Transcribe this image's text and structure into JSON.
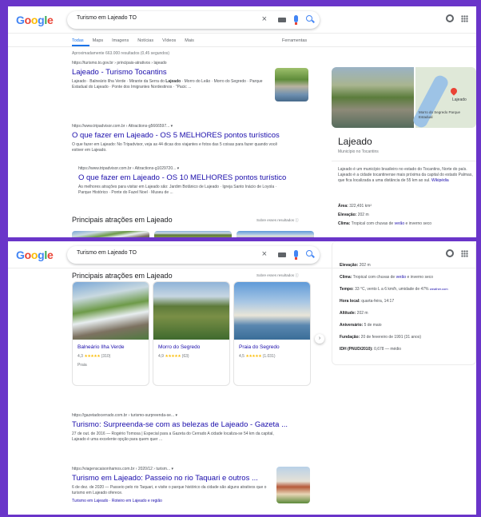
{
  "header": {
    "logo_letters": [
      "G",
      "o",
      "o",
      "g",
      "l",
      "e"
    ],
    "query": "Turismo em Lajeado TO",
    "icons": [
      "close-icon",
      "keyboard-icon",
      "mic-icon",
      "search-icon",
      "gear-icon",
      "apps-icon"
    ]
  },
  "tabs": [
    "Todas",
    "Maps",
    "Imagens",
    "Notícias",
    "Vídeos",
    "Mais"
  ],
  "tools_label": "Ferramentas",
  "stats": "Aproximadamente 663.000 resultados (0,45 segundos)",
  "results_top": [
    {
      "url": "https://turismo.to.gov.br › principais-atrativos › lajeado",
      "title": "Lajeado - Turismo Tocantins",
      "snippet_pre": "Lajeado · Balneário Ilha Verde · Mirante da Serra do ",
      "snippet_bold": "Lajeado",
      "snippet_post": " · Morro do Leão · Morro do Segredo · Parque Estadual do Lajeado · Ponte dos Imigrantes Nordestinos · \"Pacic ..."
    },
    {
      "url": "https://www.tripadvisor.com.br › Attractions-g5666597... ▾",
      "title": "O que fazer em Lajeado - OS 5 MELHORES pontos turísticos",
      "snippet": "O que fazer em Lajeado: No Tripadvisor, veja as 44 dicas dos viajantes e fotos das 5 coisas para fazer quando você estiver em Lajeado."
    },
    {
      "url": "https://www.tripadvisor.com.br › Attractions-g1029720... ▾",
      "title": "O que fazer em Lajeado - OS 10 MELHORES pontos turísticos",
      "snippet": "As melhores atrações para visitar em Lajeado são: Jardim Botânico de Lajeado · Igreja Santo Inácio de Loyola · Parque Histórico · Ponte do Fazel Noel · Museu de ..."
    }
  ],
  "attractions": {
    "title": "Principais atrações em Lajeado",
    "note": "Sobre esses resultados ⓘ",
    "cards": [
      {
        "name": "Balneário Ilha Verde",
        "rating": "4,3",
        "stars": "★★★★★",
        "reviews": "(310)",
        "type": "Praia"
      },
      {
        "name": "Morro do Segredo",
        "rating": "4,9",
        "stars": "★★★★★",
        "reviews": "(63)",
        "type": ""
      },
      {
        "name": "Praia do Segredo",
        "rating": "4,5",
        "stars": "★★★★★",
        "reviews": "(1.031)",
        "type": ""
      }
    ]
  },
  "results_bottom": [
    {
      "url": "https://gazetadocerrado.com.br › turismo-surpreenda-se... ▾",
      "title": "Turismo: Surpreenda-se com as belezas de Lajeado - Gazeta ...",
      "snippet": "27 de out. de 2016 — Rogério Tomosa | Especial para a Gazeta do Cerrado A cidade localiza-se 54 km da capital, Lajeado é uma excelente opção para quem quer ..."
    },
    {
      "url": "https://viagenscaisonhamos.com.br › 2020/12 › turism... ▾",
      "title": "Turismo em Lajeado: Passeio no rio Taquari e outros ...",
      "snippet": "6 de dez. de 2020 — Passeio pelo rio Taquari, e visite o parque histórico da cidade são alguns atrativos que o turismo em Lajeado oferece.",
      "links": "Turismo em Lajeado · Roteiro em Lajeado e região"
    }
  ],
  "knowledge_panel": {
    "map_label": "Lajeado",
    "map_poi": "Morro do Segredo Parque Estadual",
    "title": "Lajeado",
    "subtitle": "Município no Tocantins",
    "desc_pre": "Lajeado é um município brasileiro no estado do Tocantins, Norte do país. Lajeado é a cidade tocantinense mais próxima da capital do estado Palmas, que fica localizada a uma distância de 55 km ao sul. ",
    "desc_link": "Wikipédia",
    "area_label": "Área:",
    "area_value": "322,491 km²",
    "elev_label": "Elevação:",
    "elev_value": "202 m",
    "clima_label": "Clima:",
    "clima_pre": "Tropical com chuvas de ",
    "clima_link": "verão",
    "clima_post": " e inverno seco",
    "tempo_label": "Tempo:",
    "tempo_value": "33 °C, vento L a 6 km/h, umidade de 47%",
    "tempo_link": "weather.com",
    "hora_label": "Hora local:",
    "hora_value": "quarta-feira, 14:17",
    "alt_label": "Altitude:",
    "alt_value": "202 m",
    "aniv_label": "Aniversário:",
    "aniv_value": "5 de maio",
    "fund_label": "Fundação:",
    "fund_value": "20 de fevereiro de 1991 (31 anos)",
    "idh_label": "IDH (PNUD/2010):",
    "idh_value": "0,678 — médio"
  }
}
